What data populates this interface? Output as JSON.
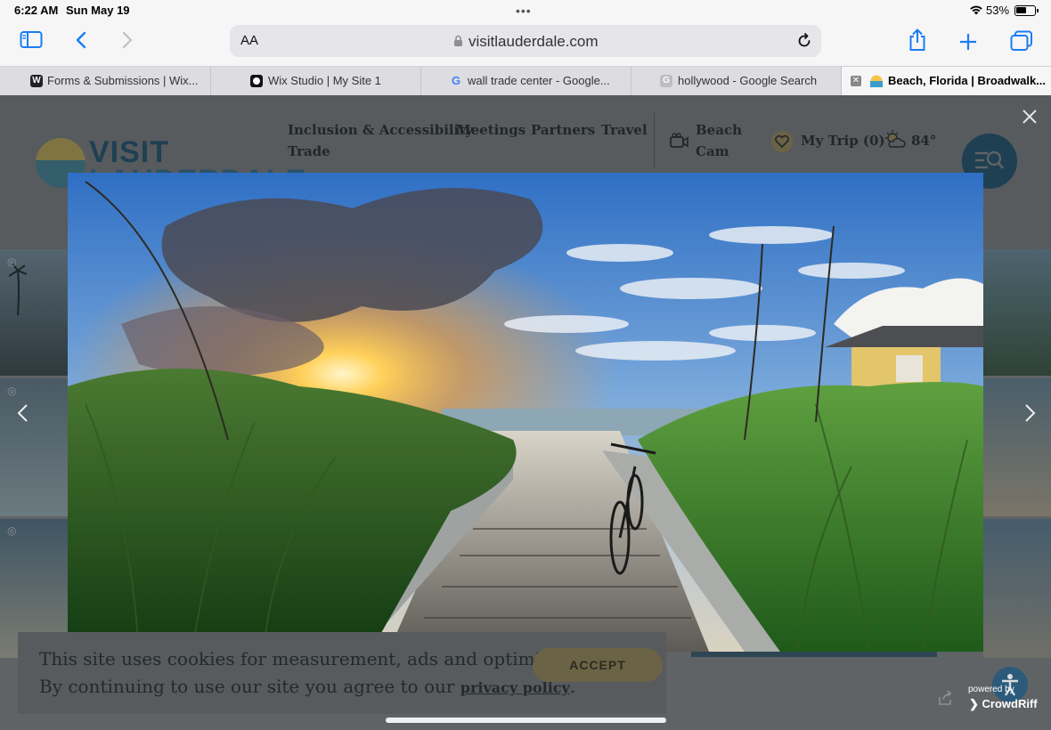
{
  "status_bar": {
    "time": "6:22 AM",
    "date": "Sun May 19",
    "battery_pct": "53%",
    "battery_level": 0.53
  },
  "toolbar": {
    "text_size_label": "AA",
    "url": "visitlauderdale.com",
    "accent_color": "#1a7cf5"
  },
  "tabs": [
    {
      "label": "Forms & Submissions | Wix...",
      "favicon": "W"
    },
    {
      "label": "Wix Studio | My Site 1",
      "favicon": "circle"
    },
    {
      "label": "wall trade center - Google...",
      "favicon": "G"
    },
    {
      "label": "hollywood - Google Search",
      "favicon": "G"
    },
    {
      "label": "Beach, Florida | Broadwalk...",
      "favicon": "beach",
      "active": true
    }
  ],
  "site": {
    "logo_text": "VISIT LAUDERDALE",
    "logo_line1": "VISIT",
    "logo_line2": "LAUDERDALE",
    "nav": {
      "inclusion": "Inclusion & Accessibility",
      "meetings": "Meetings",
      "partners": "Partners",
      "travel": "Travel",
      "trade": "Trade",
      "beach": "Beach",
      "cam": "Cam",
      "my_trip": "My Trip (0)",
      "weather": "84°"
    }
  },
  "cookie_banner": {
    "line1": "This site uses cookies for measurement, ads and optimization.",
    "line2_prefix": "By continuing to use our site you agree to our ",
    "policy_link": "privacy policy",
    "line2_suffix": ".",
    "accept_label": "ACCEPT"
  },
  "footer": {
    "powered_by": "powered by",
    "brand": "CrowdRiff"
  }
}
